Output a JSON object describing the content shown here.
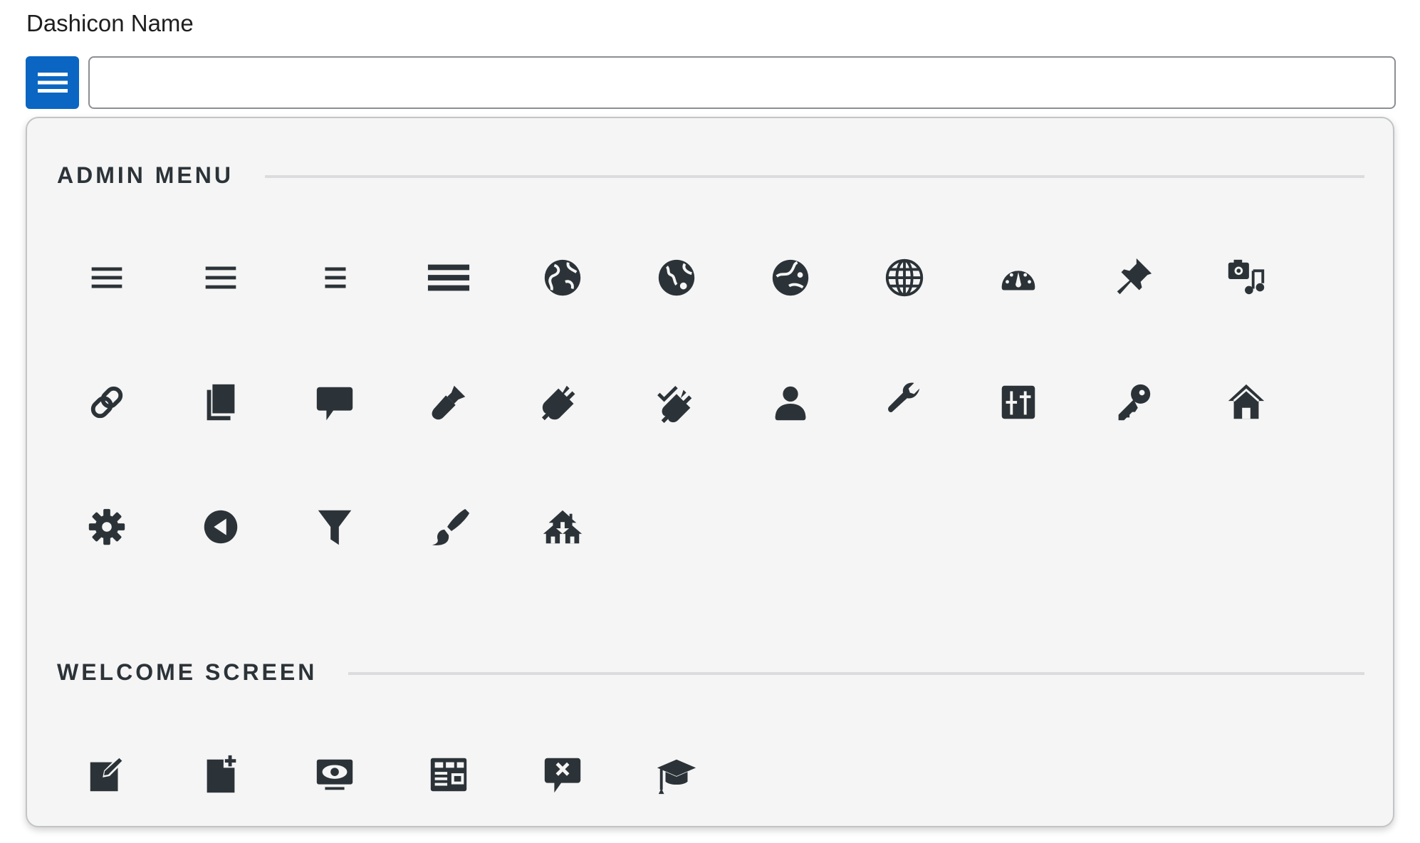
{
  "field": {
    "label": "Dashicon Name",
    "value": "",
    "placeholder": ""
  },
  "toggle": {
    "icon": "menu-icon"
  },
  "colors": {
    "accent": "#0a66c2",
    "icon": "#2c3338",
    "panel_bg": "#f4f5f4"
  },
  "sections": [
    {
      "title": "ADMIN MENU",
      "icons": [
        "menu",
        "menu-alt",
        "menu-alt2",
        "menu-alt3",
        "admin-site",
        "admin-site-alt",
        "admin-site-alt2",
        "admin-site-alt3",
        "dashboard",
        "admin-post",
        "admin-media",
        "admin-links",
        "admin-page",
        "admin-comments",
        "admin-appearance",
        "admin-plugins",
        "plugins-checked",
        "admin-users",
        "admin-tools",
        "admin-settings",
        "admin-network",
        "admin-home",
        "admin-generic",
        "admin-collapse",
        "filter",
        "admin-customizer",
        "admin-multisite"
      ]
    },
    {
      "title": "WELCOME SCREEN",
      "icons": [
        "welcome-write-blog",
        "welcome-add-page",
        "welcome-view-site",
        "welcome-widgets-menus",
        "welcome-comments",
        "welcome-learn-more"
      ]
    }
  ]
}
